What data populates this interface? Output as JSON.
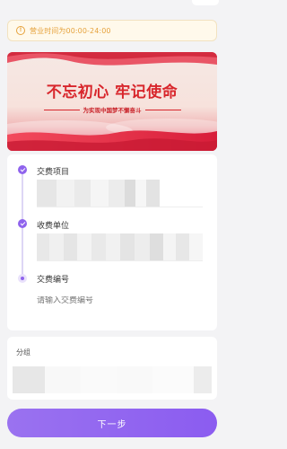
{
  "notice": {
    "text": "营业时间为00:00-24:00",
    "icon": "info-icon",
    "color": "#e6a23c"
  },
  "banner": {
    "title": "不忘初心 牢记使命",
    "subtitle": "为实现中国梦不懈奋斗",
    "accent": "#d8262c"
  },
  "form": {
    "steps": [
      {
        "label": "交费项目",
        "state": "done"
      },
      {
        "label": "收费单位",
        "state": "done"
      },
      {
        "label": "交费编号",
        "state": "current"
      }
    ],
    "payment_number_placeholder": "请输入交费编号"
  },
  "group": {
    "label": "分组"
  },
  "footer": {
    "next_label": "下一步",
    "accent": "#8f63ed"
  }
}
